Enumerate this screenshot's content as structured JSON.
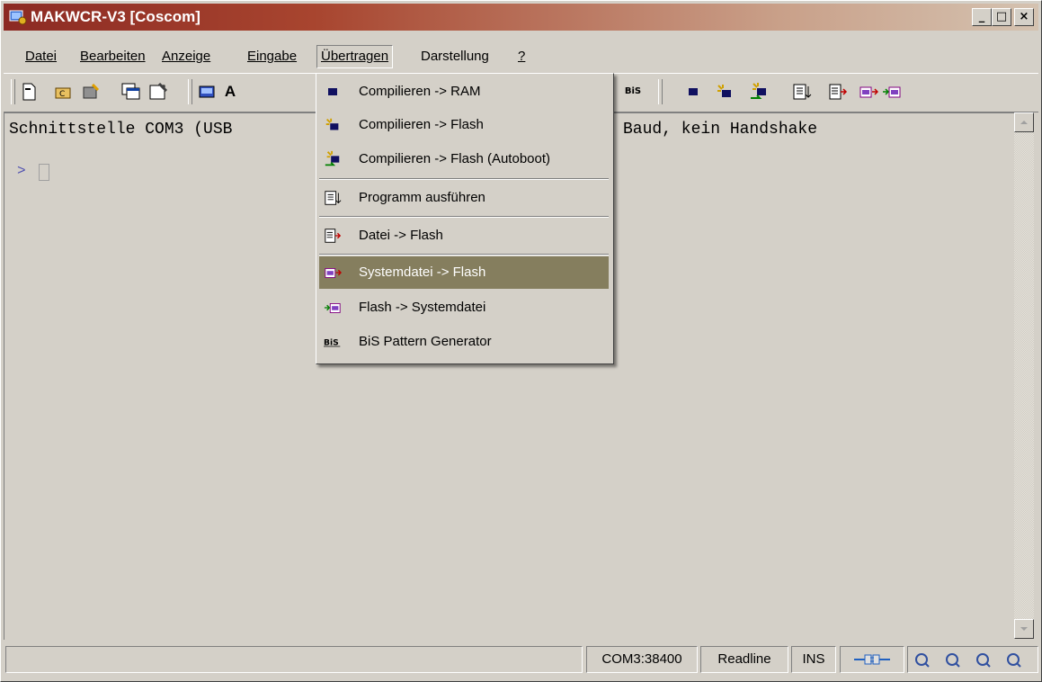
{
  "window": {
    "title": "MAKWCR-V3 [Coscom]",
    "min_label": "_",
    "max_label": "□",
    "close_label": "×"
  },
  "menubar": {
    "items": [
      {
        "label": "Datei"
      },
      {
        "label": "Bearbeiten"
      },
      {
        "label": "Anzeige"
      },
      {
        "label": "Eingabe"
      },
      {
        "label": "Übertragen"
      },
      {
        "label": "Darstellung"
      },
      {
        "label": "?"
      }
    ]
  },
  "toolbar": {
    "text_button": "A",
    "bis_label": "BiS"
  },
  "terminal": {
    "line1_left": "Schnittstelle COM3 (USB",
    "line1_right": "Baud, kein Handshake",
    "prompt": ">"
  },
  "dropdown": {
    "items": [
      {
        "label": "Compilieren -> RAM",
        "icon": "chip-icon"
      },
      {
        "label": "Compilieren -> Flash",
        "icon": "chip-sparkle-icon"
      },
      {
        "label": "Compilieren -> Flash (Autoboot)",
        "icon": "chip-autoboot-icon"
      },
      {
        "label": "Programm ausführen",
        "icon": "run-program-icon"
      },
      {
        "label": "Datei -> Flash",
        "icon": "file-to-flash-icon"
      },
      {
        "label": "Systemdatei -> Flash",
        "icon": "systemfile-to-flash-icon",
        "highlighted": true
      },
      {
        "label": "Flash -> Systemdatei",
        "icon": "flash-to-systemfile-icon"
      },
      {
        "label": "BiS Pattern Generator",
        "icon": "bis-icon"
      }
    ]
  },
  "statusbar": {
    "port": "COM3:38400",
    "mode": "Readline",
    "ins": "INS"
  },
  "colors": {
    "highlight": "#857e5e",
    "title_start": "#8c2a23",
    "face": "#d4d0c8"
  }
}
